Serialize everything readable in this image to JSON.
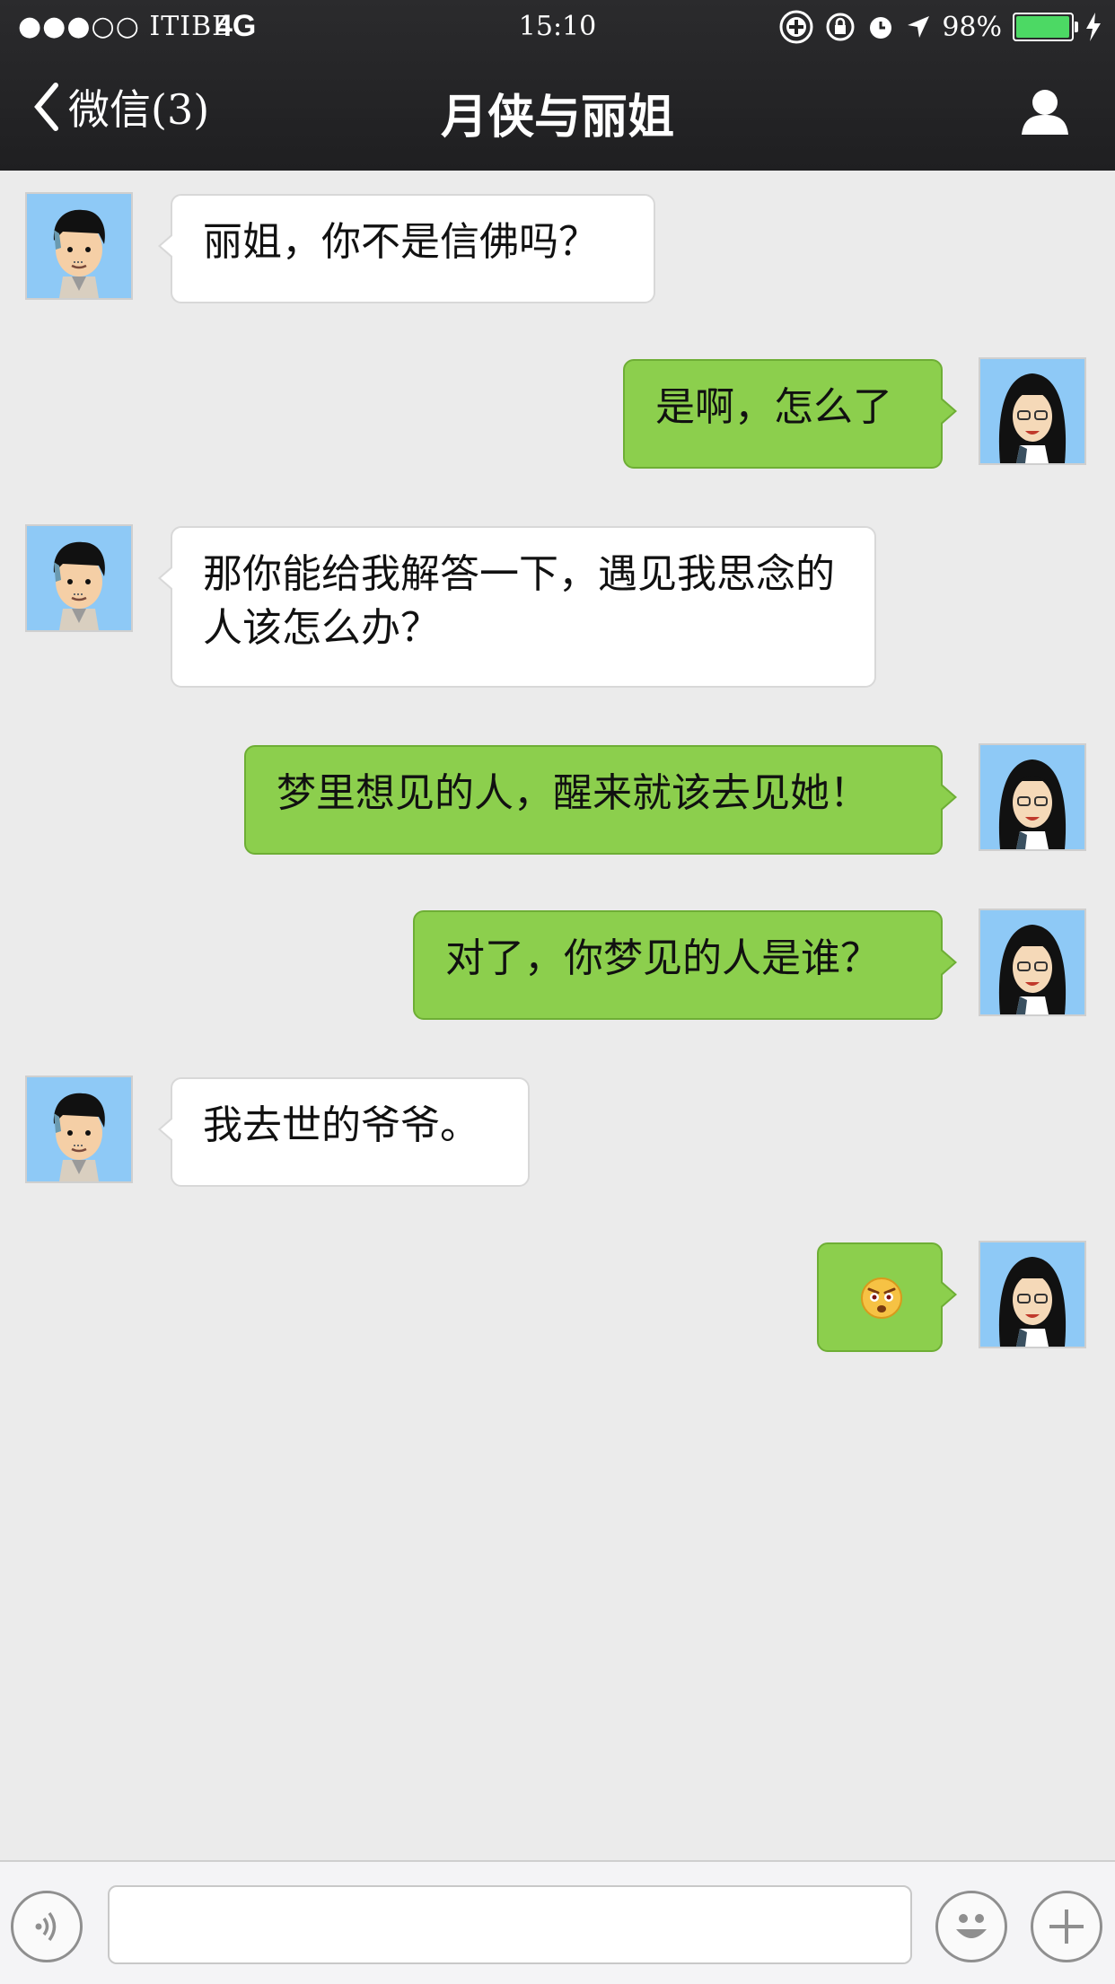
{
  "status_bar": {
    "carrier": "●●●○○ ITIBB",
    "network": "4G",
    "time": "15:10",
    "battery": "98%",
    "battery_level": 0.98
  },
  "nav": {
    "back_label": "微信(3)",
    "title": "月侠与丽姐"
  },
  "messages": [
    {
      "side": "in",
      "text": "丽姐，你不是信佛吗？"
    },
    {
      "side": "out",
      "text": "是啊，怎么了"
    },
    {
      "side": "in",
      "text": "那你能给我解答一下，遇见我思念的人该怎么办？"
    },
    {
      "side": "out",
      "text": "梦里想见的人，醒来就该去见她！"
    },
    {
      "side": "out",
      "text": "对了，你梦见的人是谁？"
    },
    {
      "side": "in",
      "text": "我去世的爷爷。"
    },
    {
      "side": "out",
      "text": "",
      "emoji": "surprised-face"
    }
  ],
  "input": {
    "value": "",
    "placeholder": ""
  },
  "colors": {
    "nav_bg": "#1f1f21",
    "chat_bg": "#ebebeb",
    "bubble_out": "#8ccf4d",
    "bubble_in": "#ffffff",
    "avatar_bg": "#8ec9f6"
  }
}
